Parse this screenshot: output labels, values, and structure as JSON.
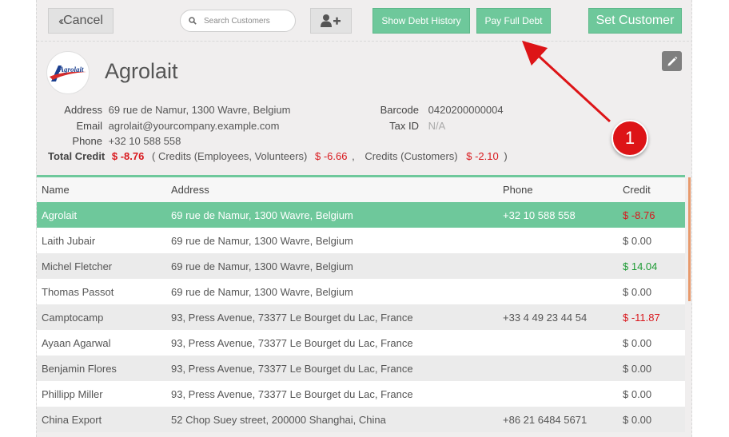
{
  "toolbar": {
    "cancel_label": "Cancel",
    "search_placeholder": "Search Customers",
    "show_debt_history_label": "Show Debt History",
    "pay_full_debt_label": "Pay Full Debt",
    "set_customer_label": "Set Customer"
  },
  "customer": {
    "logo_text": "Agrolait",
    "name": "Agrolait",
    "address_label": "Address",
    "address": "69 rue de Namur, 1300 Wavre, Belgium",
    "email_label": "Email",
    "email": "agrolait@yourcompany.example.com",
    "phone_label": "Phone",
    "phone": "+32 10 588 558",
    "barcode_label": "Barcode",
    "barcode": "0420200000004",
    "taxid_label": "Tax ID",
    "taxid": "N/A",
    "total_credit_label": "Total Credit",
    "total_credit": "$ -8.76",
    "credits_employees_label": "( Credits (Employees, Volunteers)",
    "credits_employees": "$ -6.66",
    "credits_sep": ",",
    "credits_customers_label": "Credits (Customers)",
    "credits_customers": "$ -2.10",
    "credits_close": ")"
  },
  "table": {
    "headers": [
      "Name",
      "Address",
      "Phone",
      "Credit"
    ],
    "rows": [
      {
        "name": "Agrolait",
        "address": "69 rue de Namur, 1300 Wavre, Belgium",
        "phone": "+32 10 588 558",
        "credit": "$ -8.76"
      },
      {
        "name": "Laith Jubair",
        "address": "69 rue de Namur, 1300 Wavre, Belgium",
        "phone": "",
        "credit": "$ 0.00"
      },
      {
        "name": "Michel Fletcher",
        "address": "69 rue de Namur, 1300 Wavre, Belgium",
        "phone": "",
        "credit": "$ 14.04"
      },
      {
        "name": "Thomas Passot",
        "address": "69 rue de Namur, 1300 Wavre, Belgium",
        "phone": "",
        "credit": "$ 0.00"
      },
      {
        "name": "Camptocamp",
        "address": "93, Press Avenue, 73377 Le Bourget du Lac, France",
        "phone": "+33 4 49 23 44 54",
        "credit": "$ -11.87"
      },
      {
        "name": "Ayaan Agarwal",
        "address": "93, Press Avenue, 73377 Le Bourget du Lac, France",
        "phone": "",
        "credit": "$ 0.00"
      },
      {
        "name": "Benjamin Flores",
        "address": "93, Press Avenue, 73377 Le Bourget du Lac, France",
        "phone": "",
        "credit": "$ 0.00"
      },
      {
        "name": "Phillipp Miller",
        "address": "93, Press Avenue, 73377 Le Bourget du Lac, France",
        "phone": "",
        "credit": "$ 0.00"
      },
      {
        "name": "China Export",
        "address": "52 Chop Suey street, 200000 Shanghai, China",
        "phone": "+86 21 6484 5671",
        "credit": "$ 0.00"
      }
    ]
  },
  "annotation": {
    "badge_number": "1",
    "color": "#dd1417"
  },
  "colors": {
    "accent_green": "#6ec89b",
    "negative_red": "#d9191e",
    "positive_green": "#1e9b35"
  }
}
